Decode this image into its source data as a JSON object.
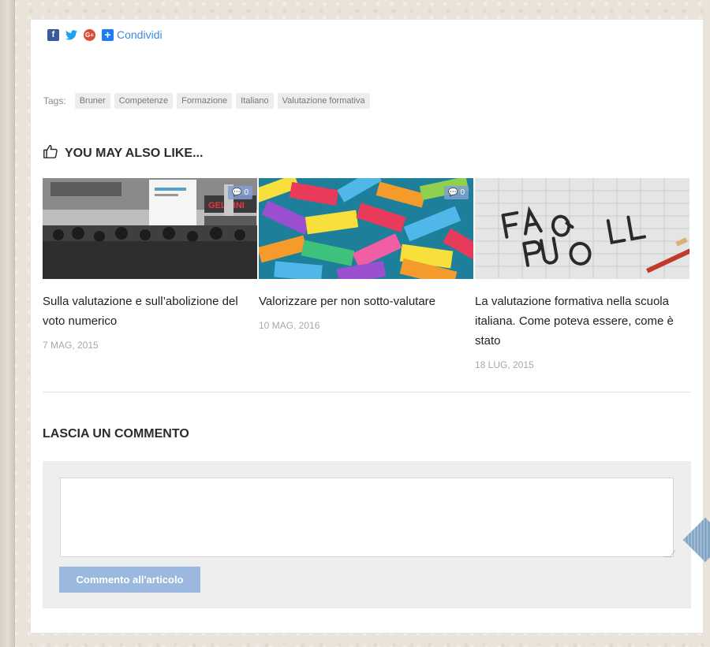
{
  "share": {
    "icons": [
      "facebook-icon",
      "twitter-icon",
      "google-plus-icon",
      "plus-icon"
    ],
    "label": "Condividi"
  },
  "tags": {
    "label": "Tags:",
    "items": [
      "Bruner",
      "Competenze",
      "Formazione",
      "Italiano",
      "Valutazione formativa"
    ]
  },
  "related": {
    "heading": "YOU MAY ALSO LIKE...",
    "heading_icon": "thumbs-up-icon",
    "items": [
      {
        "title": "Sulla valutazione e sull’abolizione del voto numerico",
        "date": "7 MAG, 2015",
        "comments": "0"
      },
      {
        "title": "Valorizzare per non sotto-valutare",
        "date": "10 MAG, 2016",
        "comments": "0"
      },
      {
        "title": "La valutazione formativa nella scuola italiana. Come poteva essere, come è stato",
        "date": "18 LUG, 2015",
        "comments": ""
      }
    ]
  },
  "comment_form": {
    "heading": "LASCIA UN COMMENTO",
    "textarea_value": "",
    "submit_label": "Commento all'articolo"
  },
  "colors": {
    "link": "#3d8be0",
    "button": "#9bb8de",
    "form_bg": "#eeeeee",
    "tag_bg": "#ededed"
  }
}
